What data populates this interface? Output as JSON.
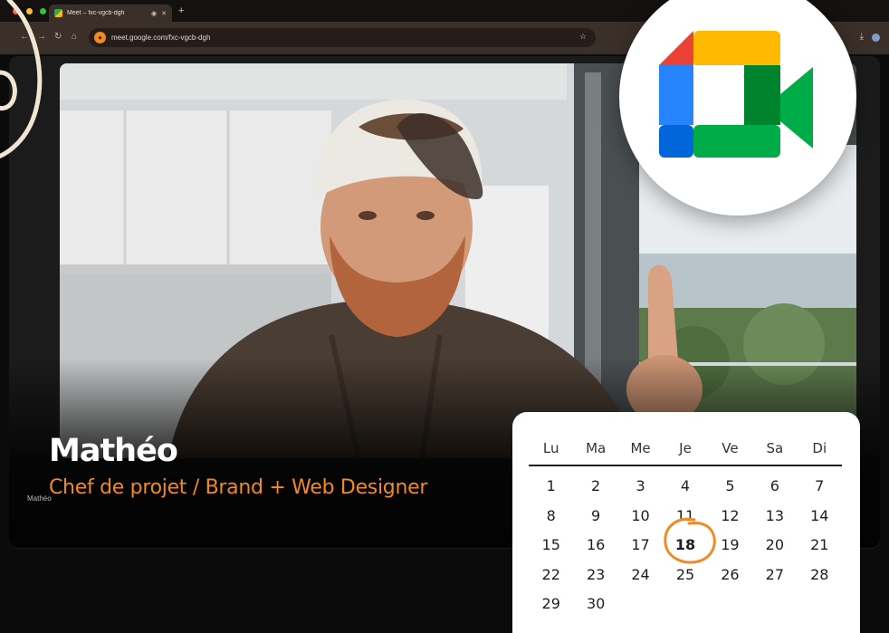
{
  "browser": {
    "tab_title": "Meet – fxc-vgcb-dgh",
    "new_tab": "+",
    "url": "meet.google.com/fxc-vgcb-dgh"
  },
  "meet": {
    "tile_label": "Mathéo"
  },
  "person": {
    "name": "Mathéo",
    "role": "Chef de projet / Brand + Web Designer"
  },
  "calendar": {
    "weekdays": [
      "Lu",
      "Ma",
      "Me",
      "Je",
      "Ve",
      "Sa",
      "Di"
    ],
    "days": [
      [
        "1",
        "2",
        "3",
        "4",
        "5",
        "6",
        "7"
      ],
      [
        "8",
        "9",
        "10",
        "11",
        "12",
        "13",
        "14"
      ],
      [
        "15",
        "16",
        "17",
        "18",
        "19",
        "20",
        "21"
      ],
      [
        "22",
        "23",
        "24",
        "25",
        "26",
        "27",
        "28"
      ],
      [
        "29",
        "30",
        "",
        "",
        "",
        "",
        ""
      ]
    ],
    "highlighted_day": "18"
  },
  "colors": {
    "accent": "#f08a24",
    "chrome": "#3b2f2a",
    "meet_green": "#00ac47",
    "meet_yellow": "#ffba00",
    "meet_blue": "#2684fc",
    "meet_red": "#ea4335"
  },
  "icons": [
    "back-icon",
    "forward-icon",
    "reload-icon",
    "home-icon",
    "site-icon",
    "star-icon",
    "download-icon",
    "google-meet-logo"
  ]
}
